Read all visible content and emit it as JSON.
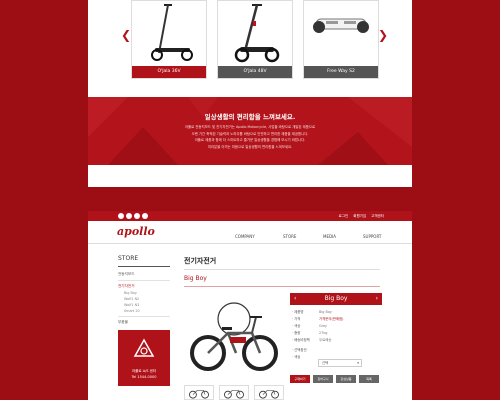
{
  "panel1": {
    "products": [
      {
        "name": "O'Jala 36V"
      },
      {
        "name": "O'Jala 48V"
      },
      {
        "name": "Free Way S2"
      }
    ],
    "banner": {
      "title": "일상생활의 편리함을 느껴보세요.",
      "body_lines": [
        "아폴로 전동킥보드 및 전기자전거는 Apollo Motorcycle, 사업을 바탕으로 개발된 제품으로",
        "오랜 기간 축적된 기술력과 노하우를 바탕으로 안전하고 편리한 제품을 제공합니다.",
        "아폴로 제품과 함께 더 스마트하고 즐거운 일상생활을 경험해 보시기 바랍니다.",
        "여러분을 아끼는 마음으로 일상생활의 편리함을 느껴보세요."
      ]
    }
  },
  "panel2": {
    "top_links": [
      "로그인",
      "회원가입",
      "고객센터"
    ],
    "logo": "apollo",
    "nav": [
      "COMPANY",
      "STORE",
      "MEDIA",
      "SUPPORT"
    ],
    "sidebar": {
      "title": "STORE",
      "items": [
        "전동킥보드",
        "전기자전거"
      ],
      "sub_items": [
        "Big Boy",
        "Wolf1 N2",
        "Wolf1 N3",
        "Smart 20"
      ],
      "extra_item": "부품몰",
      "promo_lines": [
        "아폴로 A/S 센터",
        "Tel 1544-0000"
      ]
    },
    "page_title": "전기자전거",
    "product_title": "Big Boy",
    "info": {
      "title": "Big Boy",
      "prev": "‹",
      "next": "›",
      "specs": [
        {
          "key": "· 제품명",
          "value": "Big Boy",
          "highlight": false
        },
        {
          "key": "· 가격",
          "value": "가격문의(판매점)",
          "highlight": true
        },
        {
          "key": "· 색상",
          "value": "Grey",
          "highlight": false
        },
        {
          "key": "· 중량",
          "value": "27kg",
          "highlight": false
        },
        {
          "key": "· 배송비정책",
          "value": "무료배송",
          "highlight": false
        }
      ],
      "option_label": "· 선택옵션",
      "option_key": "· 색상",
      "select_value": "선택",
      "buttons": [
        "구매하기",
        "장바구니",
        "관심상품",
        "목록"
      ]
    },
    "colors": {
      "accent": "#b0121a",
      "background": "#9c0e14"
    }
  }
}
